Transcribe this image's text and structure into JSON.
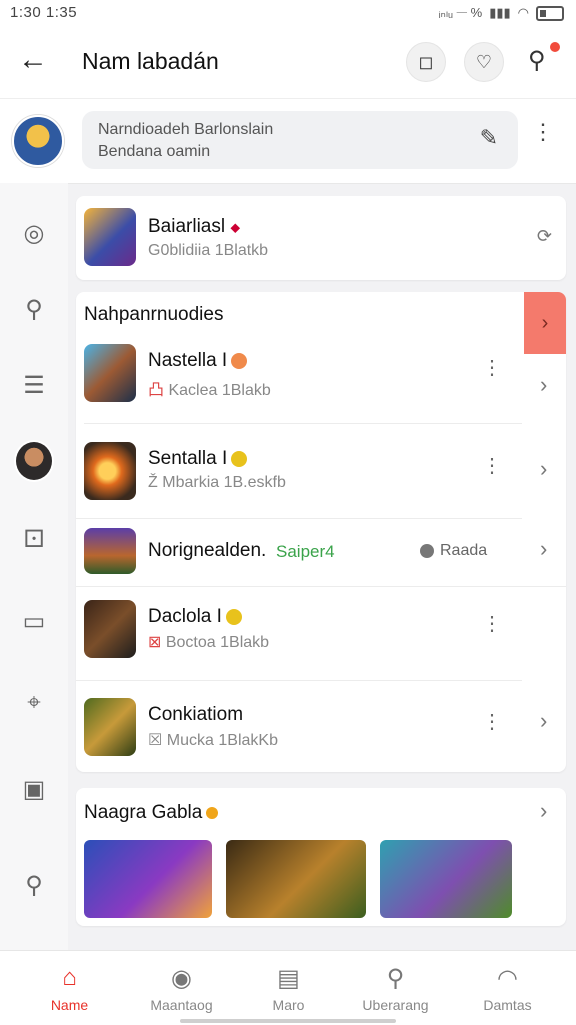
{
  "status": {
    "time": "1:30 1:35",
    "right_text": "ᵢₙₗᵤ 𝄖 %",
    "colors": {
      "bg": "#ffffff"
    }
  },
  "topbar": {
    "title": "Nam labadán",
    "icons": [
      "back-arrow-icon",
      "camera-icon",
      "heart-icon",
      "search-icon"
    ]
  },
  "profile": {
    "search_line1": "Narndioadeh Barlonslain",
    "search_line2": "Bendana oamin"
  },
  "featured": {
    "name": "Baiarliasl",
    "sub": "G0blidiia 1Blatkb"
  },
  "section_title": "Nahpanrnuodies",
  "items": [
    {
      "name": "Nastella I",
      "sub": "Kaclea 1Blakb",
      "badge_color": "#f08a4b",
      "sub_prefix": "凸"
    },
    {
      "name": "Sentalla I",
      "sub": "Mbarkia 1B.eskfb",
      "badge_color": "#e8c21c",
      "sub_prefix": "Ž"
    },
    {
      "name": "Norignealden.",
      "tag": "Saiper4",
      "right_label": "Raada"
    },
    {
      "name": "Daclola I",
      "sub": "Boctoa 1Blakb",
      "badge_color": "#e8c21c",
      "sub_prefix": "⊠"
    },
    {
      "name": "Conkiatiom",
      "sub": "Mucka 1BlakKb",
      "sub_prefix": "☒"
    }
  ],
  "games_section": {
    "title": "Naagra Gabla"
  },
  "bottom_nav": [
    {
      "label": "Name",
      "icon": "home-icon",
      "active": true
    },
    {
      "label": "Maantaog",
      "icon": "compass-icon",
      "active": false
    },
    {
      "label": "Maro",
      "icon": "list-icon",
      "active": false
    },
    {
      "label": "Uberarang",
      "icon": "search-icon",
      "active": false
    },
    {
      "label": "Damtas",
      "icon": "profile-icon",
      "active": false
    }
  ],
  "accent": "#e8322a"
}
